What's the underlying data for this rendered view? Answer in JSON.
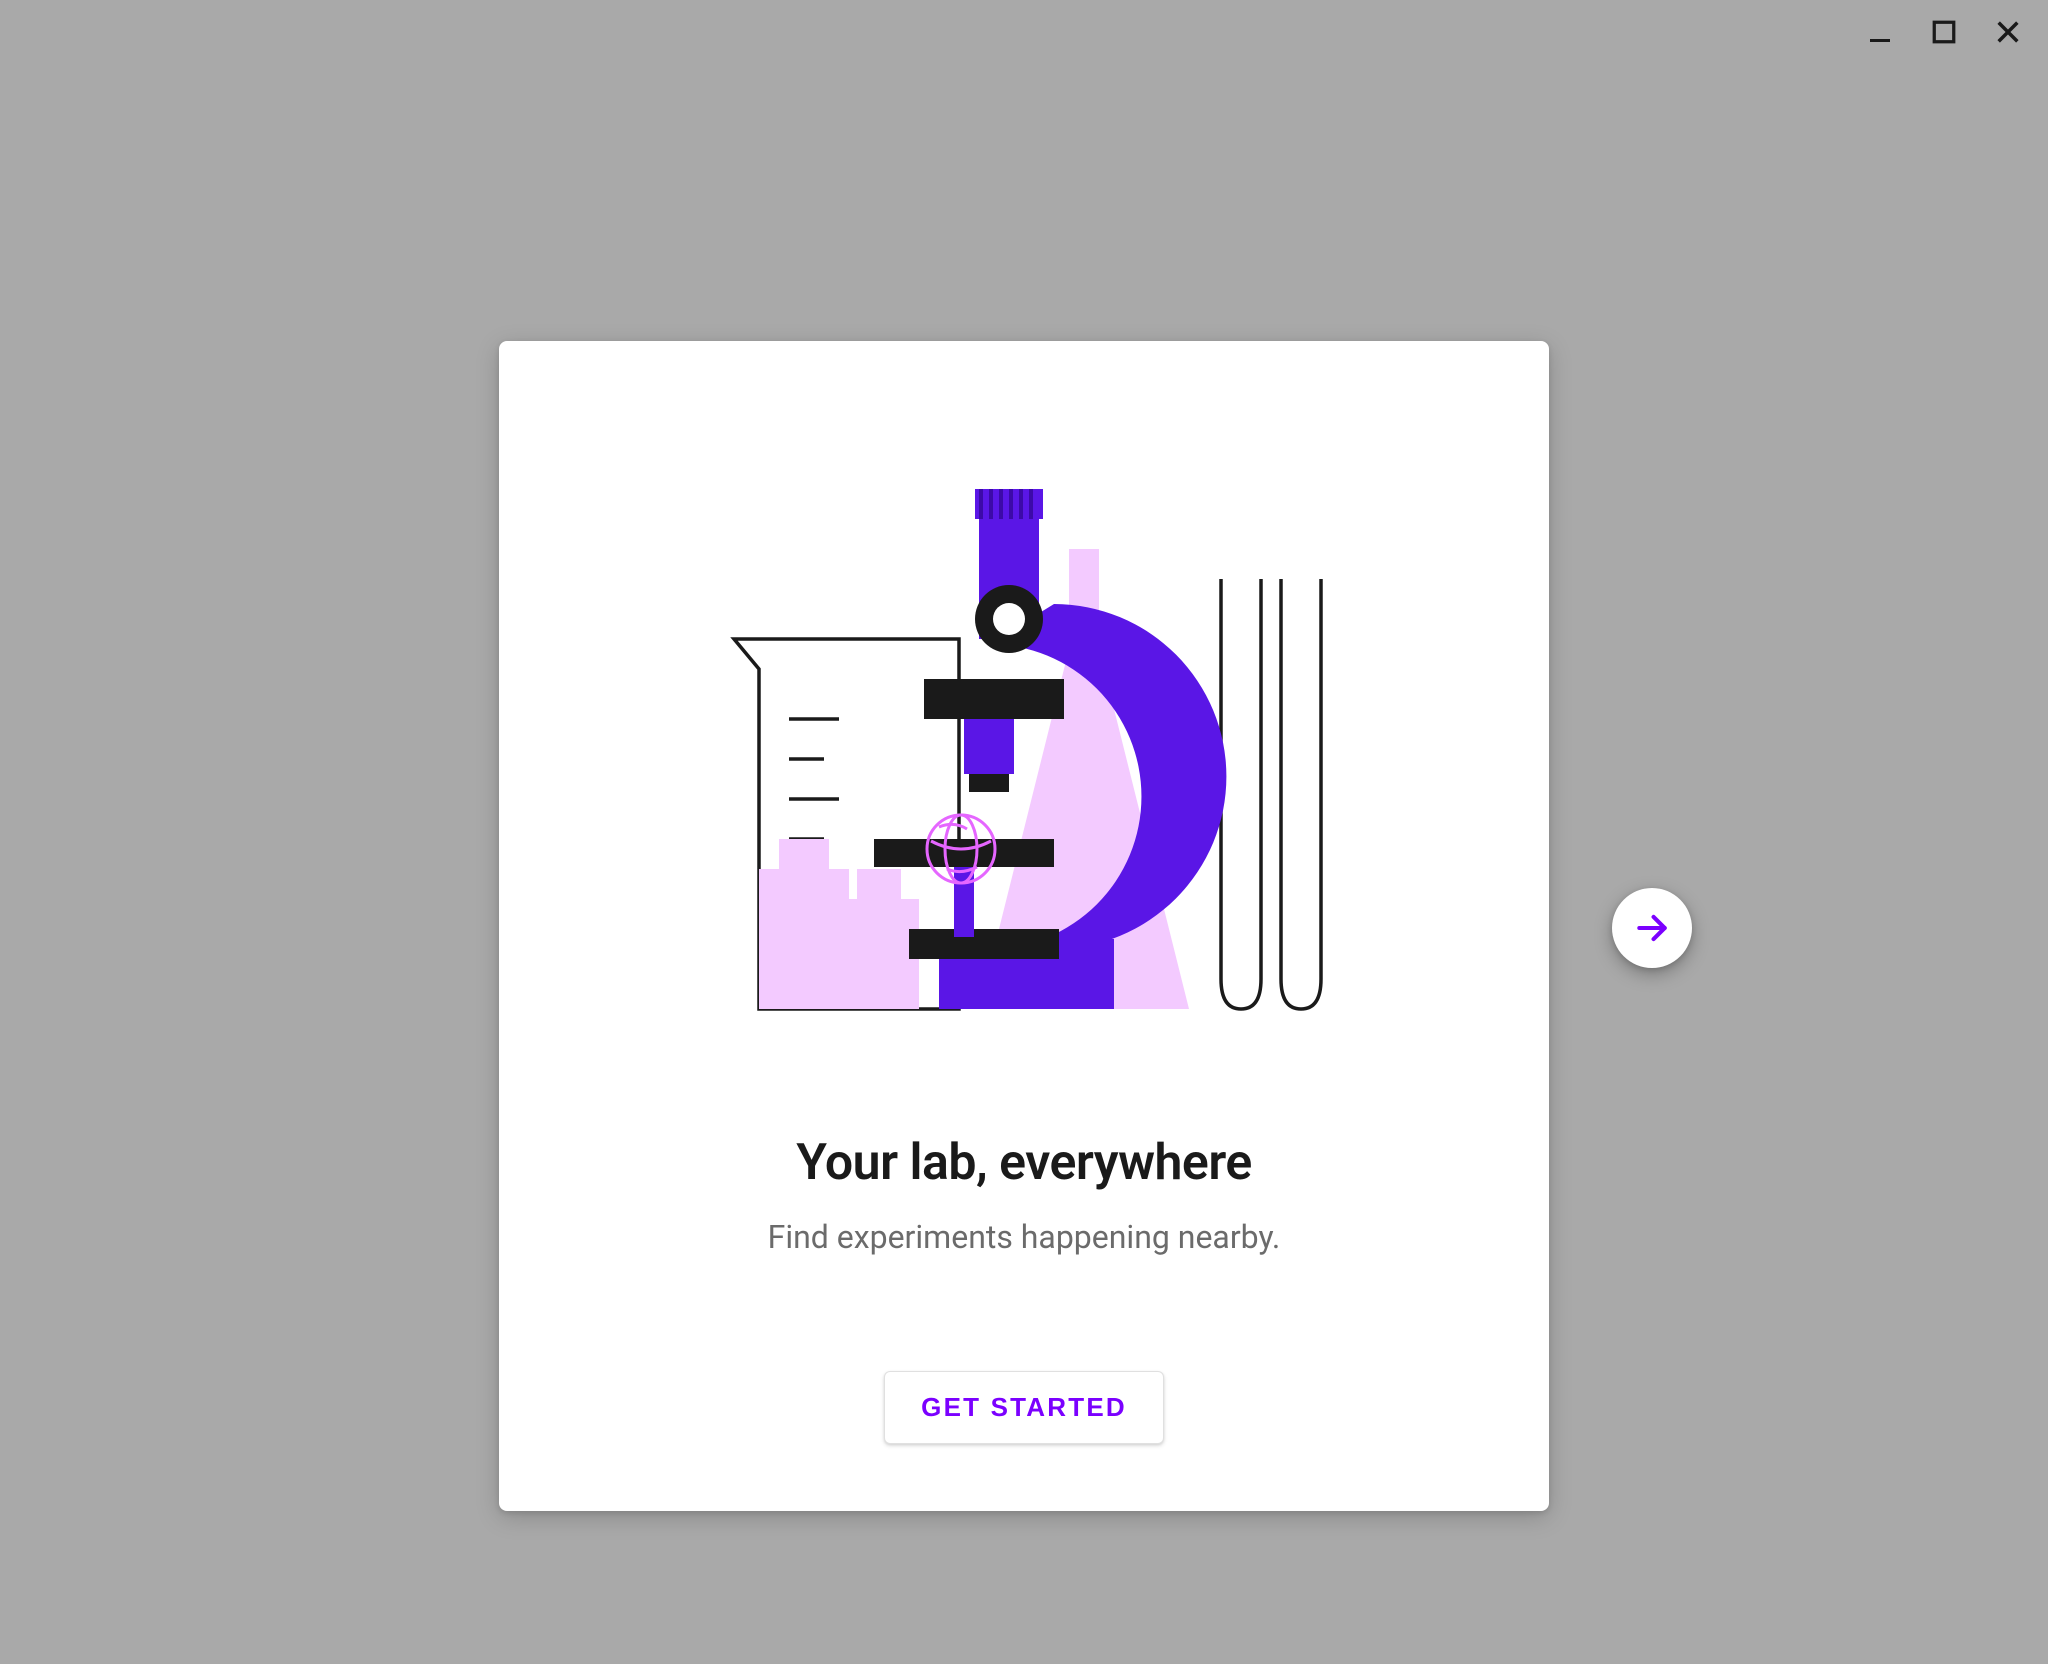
{
  "titlebar": {
    "minimize_label": "minimize",
    "maximize_label": "maximize",
    "close_label": "close"
  },
  "onboarding": {
    "title": "Your lab, everywhere",
    "subtitle": "Find experiments happening nearby.",
    "cta_label": "GET STARTED",
    "illustration_name": "microscope-lab-illustration"
  },
  "nav": {
    "next_label": "next"
  },
  "colors": {
    "accent": "#7b00ff",
    "accent_light": "#f3caff",
    "text_primary": "#1a1a1a",
    "text_secondary": "#6b6b6b",
    "surface": "#ffffff",
    "backdrop": "#a9a9a9"
  }
}
